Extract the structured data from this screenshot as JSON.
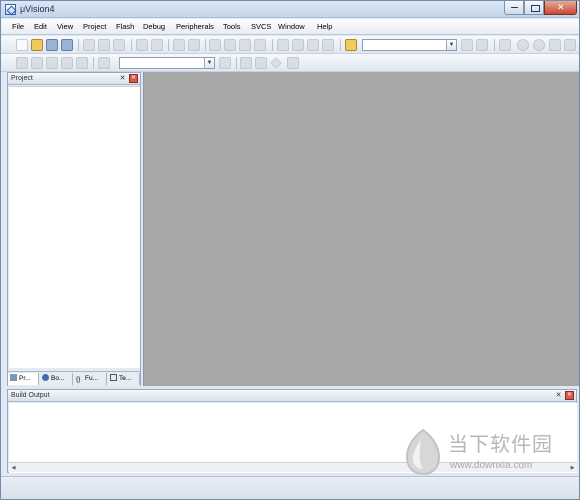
{
  "window": {
    "title": "μVision4"
  },
  "menu": [
    "File",
    "Edit",
    "View",
    "Project",
    "Flash",
    "Debug",
    "Peripherals",
    "Tools",
    "SVCS",
    "Window",
    "Help"
  ],
  "project_panel": {
    "title": "Project",
    "tabs": [
      "Pr...",
      "Bo...",
      "Fu...",
      "Te..."
    ]
  },
  "output_panel": {
    "title": "Build Output"
  },
  "watermark": {
    "brand": "当下软件园",
    "url": "www.downxia.com"
  }
}
